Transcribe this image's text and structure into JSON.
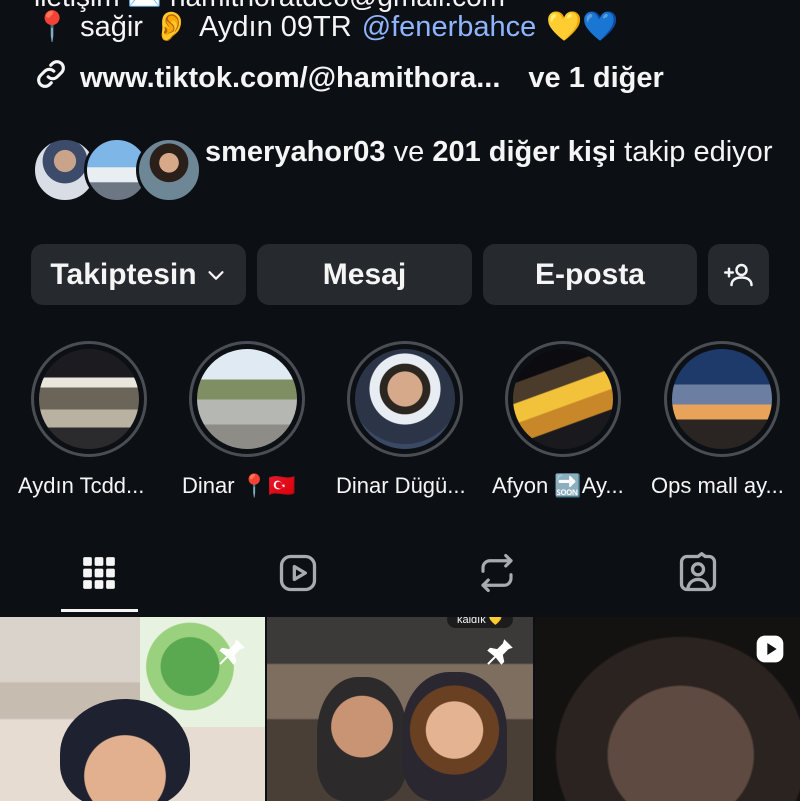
{
  "bio": {
    "cut_line": "iletişim ✉️ hamithoratdeo@gmail.com",
    "location_icon": "📍",
    "line1_text": "sağir",
    "ear_icon": "👂",
    "city": "Aydın 09TR",
    "mention": "@fenerbahce",
    "hearts": "💛💙",
    "link": "www.tiktok.com/@hamithora...",
    "link_more": "ve 1 diğer"
  },
  "followed_by": {
    "user": "smeryahor03",
    "connector": "ve",
    "others": "201 diğer kişi",
    "suffix": "takip ediyor"
  },
  "actions": {
    "following_label": "Takiptesin",
    "message_label": "Mesaj",
    "email_label": "E-posta"
  },
  "highlights": [
    {
      "label": "Aydın  Tcdd..."
    },
    {
      "label": "Dinar 📍🇹🇷"
    },
    {
      "label": "Dinar Dügü..."
    },
    {
      "label": "Afyon 🔜Ay..."
    },
    {
      "label": "Ops mall ay..."
    }
  ],
  "tabs": [
    "grid-icon",
    "reels-icon",
    "reposts-icon",
    "tagged-icon"
  ],
  "grid_badges": {
    "cell2_tag": "kaldık 💛"
  },
  "colors": {
    "background": "#0c1014",
    "button": "#262a2f",
    "mention": "#8fb4ff",
    "ring": "#4a4e54"
  }
}
